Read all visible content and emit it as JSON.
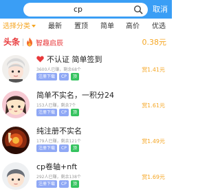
{
  "search": {
    "value": "cp",
    "cancel_label": "取消"
  },
  "filters": [
    "选择分类",
    "最新",
    "置顶",
    "简单",
    "高价",
    "优选"
  ],
  "headline": {
    "tag": "头条",
    "title": "智趣启辰",
    "price": "0.38元"
  },
  "tasks": [
    {
      "title": "不认证 简单签到",
      "stats": "3600人已赚，剩余68个",
      "tags": [
        "注册下载",
        "CP",
        "顶"
      ],
      "reward": "赏1.41元",
      "heart": true
    },
    {
      "title": "简单不实名，一积分24",
      "stats": "153人已赚，剩余7个",
      "tags": [
        "注册下载",
        "CP",
        "顶"
      ],
      "reward": "赏1.61元",
      "heart": false
    },
    {
      "title": "纯注册不实名",
      "stats": "179人已赚，剩余121个",
      "tags": [
        "注册下载",
        "CP",
        "顶"
      ],
      "reward": "赏1.49元",
      "heart": false
    },
    {
      "title": "cp卷轴+nft",
      "stats": "292人已赚，剩余138个",
      "tags": [
        "注册下载",
        "CP",
        "顶"
      ],
      "reward": "赏1.69元",
      "heart": false
    }
  ],
  "colors": {
    "header": "#3a9ef5",
    "accent": "#f5a623",
    "headline_red": "#e8393b",
    "tag_blue": "#8fa8f5",
    "tag_green": "#35c35f"
  }
}
